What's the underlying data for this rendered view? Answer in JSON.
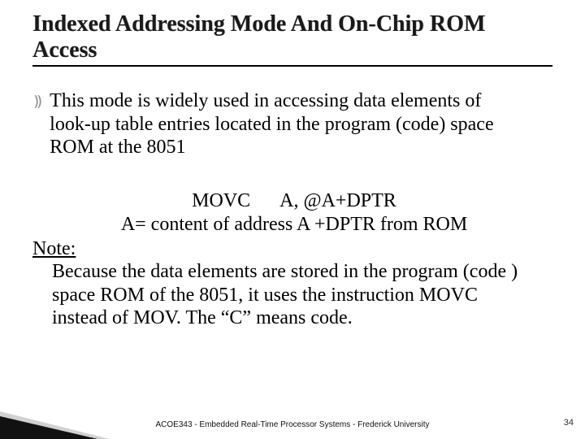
{
  "title": "Indexed Addressing Mode And On-Chip ROM Access",
  "bullet": {
    "marker": "⸩",
    "text": "This mode is widely used in accessing data elements of look-up table entries located in the program  (code) space ROM at the 8051"
  },
  "code": {
    "line1": "MOVC  A, @A+DPTR",
    "line2": "A= content of address A +DPTR from ROM"
  },
  "note": {
    "label": "Note:",
    "text": "Because the data elements are stored in the program (code ) space ROM of the 8051, it uses the instruction MOVC instead of MOV. The “C” means code."
  },
  "footer": "ACOE343 - Embedded Real-Time Processor Systems - Frederick University",
  "page_number": "34"
}
